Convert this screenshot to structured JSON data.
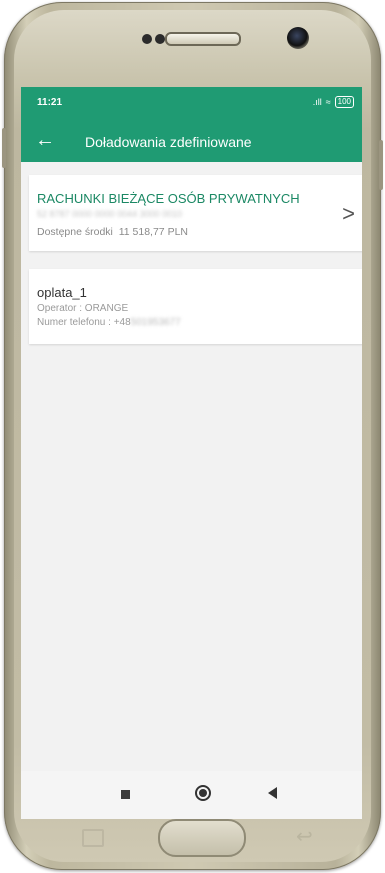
{
  "status_bar": {
    "time": "11:21",
    "signal": ".ıll",
    "wifi": "≈",
    "battery": "100"
  },
  "app_bar": {
    "back_icon": "arrow-left-icon",
    "title": "Doładowania zdefiniowane"
  },
  "account": {
    "name": "RACHUNKI BIEŻĄCE OSÓB PRYWATNYCH",
    "number_masked": "52 8787 0000 0000 0044 3000 0010",
    "balance_label": "Dostępne środki",
    "balance_value": "11 518,77 PLN",
    "chevron_icon": "chevron-right-icon"
  },
  "topup": {
    "name": "oplata_1",
    "operator": "Operator : ORANGE",
    "phone_label": "Numer telefonu : +48",
    "phone_masked": "501953677"
  },
  "nav": {
    "recents_icon": "square-icon",
    "home_icon": "circle-icon",
    "back_icon": "triangle-back-icon"
  }
}
